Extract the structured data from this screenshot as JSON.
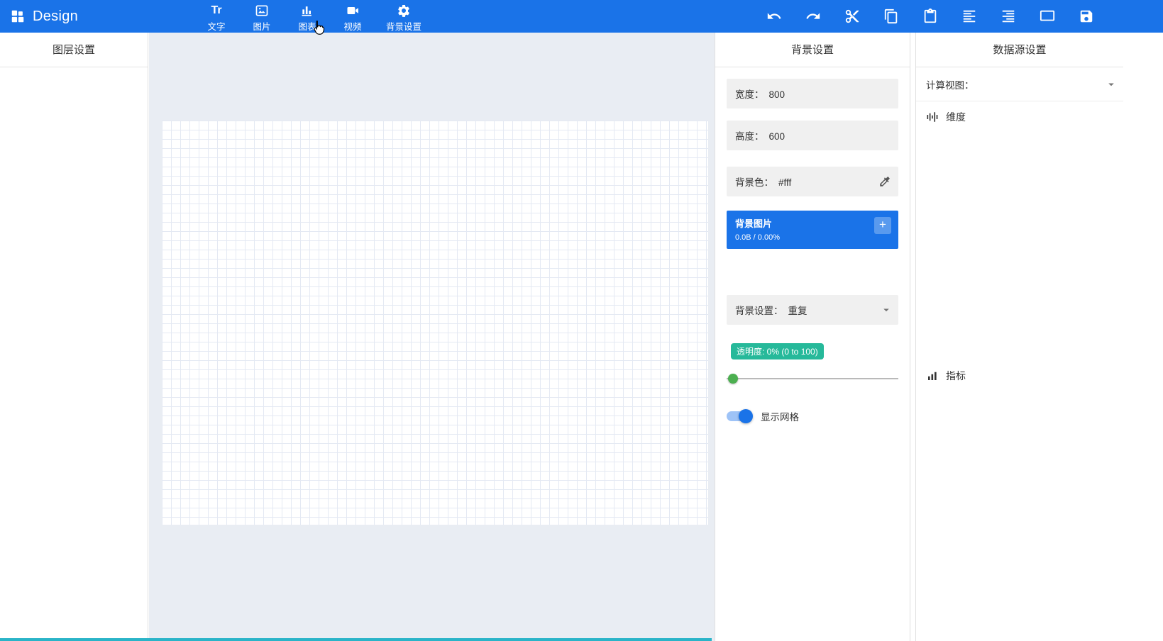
{
  "colors": {
    "accent": "#1a73e8",
    "badge_green": "#26b99a",
    "slider_green": "#4caf50",
    "toggle_on": "#1a73e8",
    "scrollbar": "#2ab4c8"
  },
  "header": {
    "title": "Design",
    "tools": [
      {
        "label": "文字",
        "glyph": "Tr"
      },
      {
        "label": "图片"
      },
      {
        "label": "图表"
      },
      {
        "label": "视频"
      },
      {
        "label": "背景设置"
      }
    ]
  },
  "layers_panel": {
    "title": "图层设置"
  },
  "background_panel": {
    "title": "背景设置",
    "width": {
      "label": "宽度：",
      "value": "800"
    },
    "height": {
      "label": "高度：",
      "value": "600"
    },
    "bg_color": {
      "label": "背景色：",
      "value": "#fff"
    },
    "bg_image": {
      "label": "背景图片",
      "meta": "0.0B / 0.00%",
      "plus": "+"
    },
    "bg_repeat": {
      "label": "背景设置：",
      "value": "重复"
    },
    "opacity": {
      "badge": "透明度: 0% (0 to 100)",
      "value": "0"
    },
    "grid_toggle": {
      "label": "显示网格",
      "state": "on"
    }
  },
  "datasource_panel": {
    "title": "数据源设置",
    "view_label": "计算视图：",
    "dimension_label": "维度",
    "metric_label": "指标"
  }
}
